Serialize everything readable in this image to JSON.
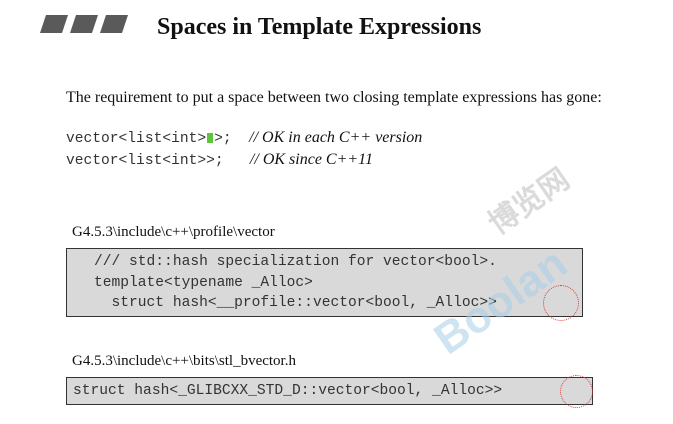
{
  "title": "Spaces in Template Expressions",
  "intro": "The requirement to put a space between two closing template expressions has gone:",
  "examples": [
    {
      "code_before": "vector<list<int>",
      "code_after": ">;",
      "comment": "// OK in each C++ version"
    },
    {
      "code": "vector<list<int>>;",
      "comment": "// OK since C++11"
    }
  ],
  "snippets": [
    {
      "path": "G4.5.3\\include\\c++\\profile\\vector",
      "lines": [
        "/// std::hash specialization for vector<bool>.",
        "template<typename _Alloc>",
        "  struct hash<__profile::vector<bool, _Alloc>>"
      ]
    },
    {
      "path": "G4.5.3\\include\\c++\\bits\\stl_bvector.h",
      "lines": [
        "struct hash<_GLIBCXX_STD_D::vector<bool, _Alloc>>"
      ]
    }
  ],
  "watermark": {
    "brand": "Boolan",
    "chinese": "博览网"
  },
  "colors": {
    "bars": "#5a5a5a",
    "code_box": "#d9d9d9",
    "gap_marker": "#5ec43a",
    "highlight_circle": "#d33c3c",
    "watermark": "#a9cfe8"
  }
}
